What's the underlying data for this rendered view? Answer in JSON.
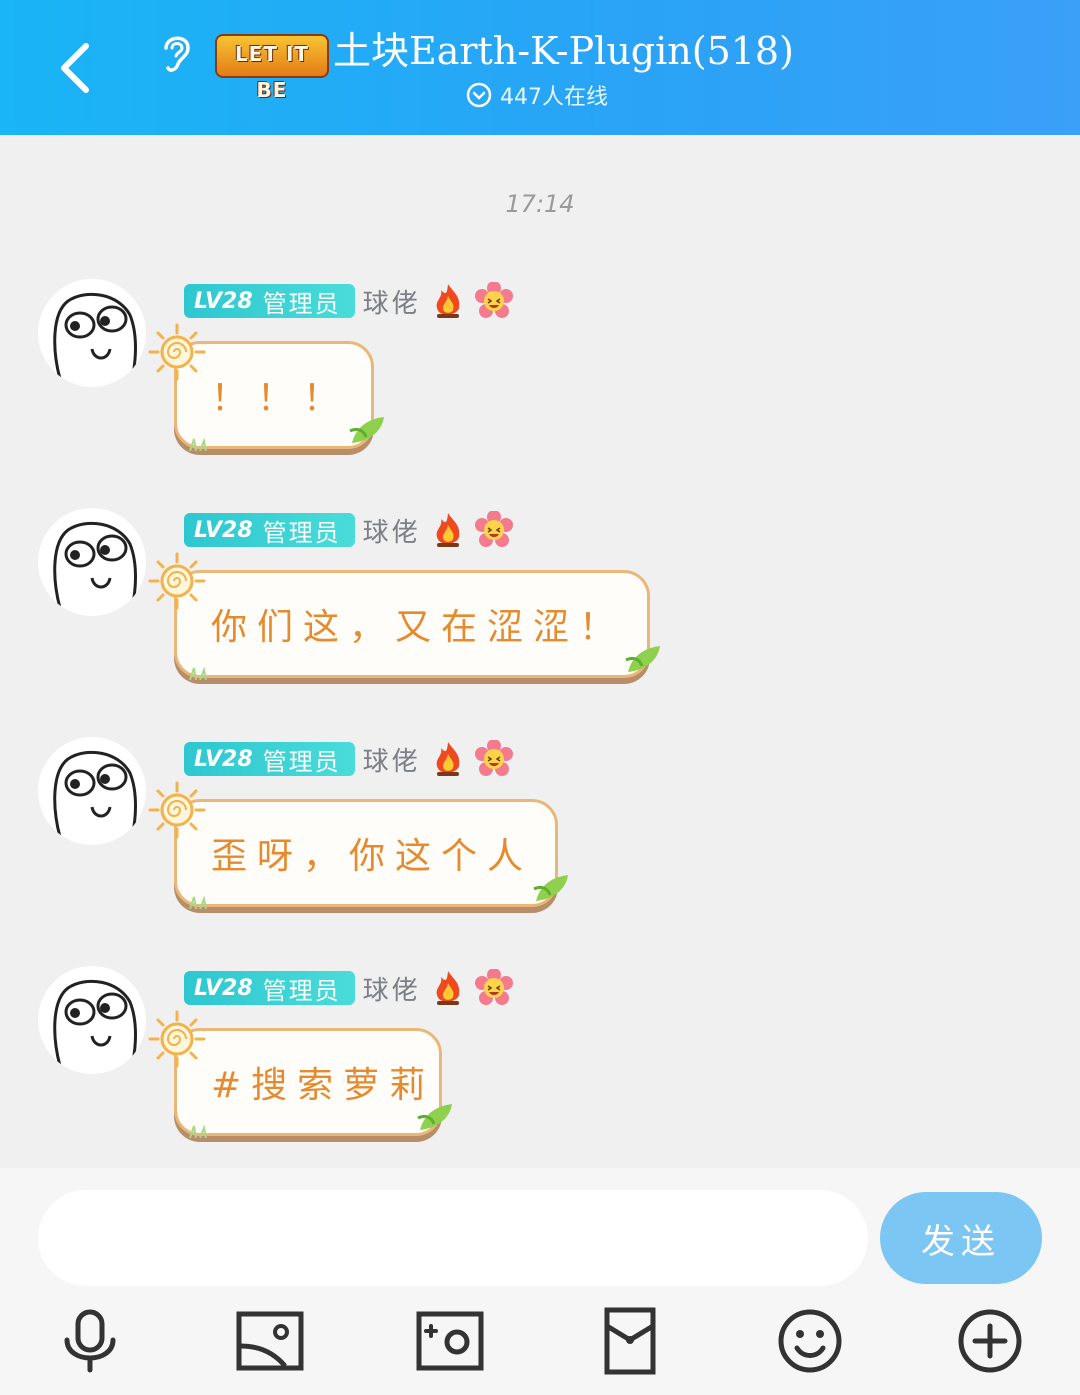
{
  "header": {
    "badge_text": "LET IT BE",
    "group_title": "土块Earth-K-Plugin(518)",
    "online_text": "447人在线"
  },
  "timestamp": "17:14",
  "messages": [
    {
      "level": "LV28",
      "role": "管理员",
      "nickname": "球佬",
      "text": "！！！"
    },
    {
      "level": "LV28",
      "role": "管理员",
      "nickname": "球佬",
      "text": "你们这，又在涩涩！"
    },
    {
      "level": "LV28",
      "role": "管理员",
      "nickname": "球佬",
      "text": "歪呀，你这个人"
    },
    {
      "level": "LV28",
      "role": "管理员",
      "nickname": "球佬",
      "text": "#搜索萝莉"
    }
  ],
  "input": {
    "value": "",
    "send_label": "发送"
  },
  "colors": {
    "header_start": "#19b5f5",
    "header_end": "#3aa0f8",
    "bubble_text": "#e68a2e",
    "bubble_border": "#e9b878",
    "level_badge": "#2ec7d0",
    "send_button": "#7cc6f3"
  },
  "icons": {
    "back": "chevron-left-icon",
    "ear": "ear-icon",
    "online": "chevron-down-circle-icon",
    "toolbar": [
      "microphone-icon",
      "image-icon",
      "camera-icon",
      "red-packet-icon",
      "emoji-icon",
      "plus-icon"
    ]
  }
}
